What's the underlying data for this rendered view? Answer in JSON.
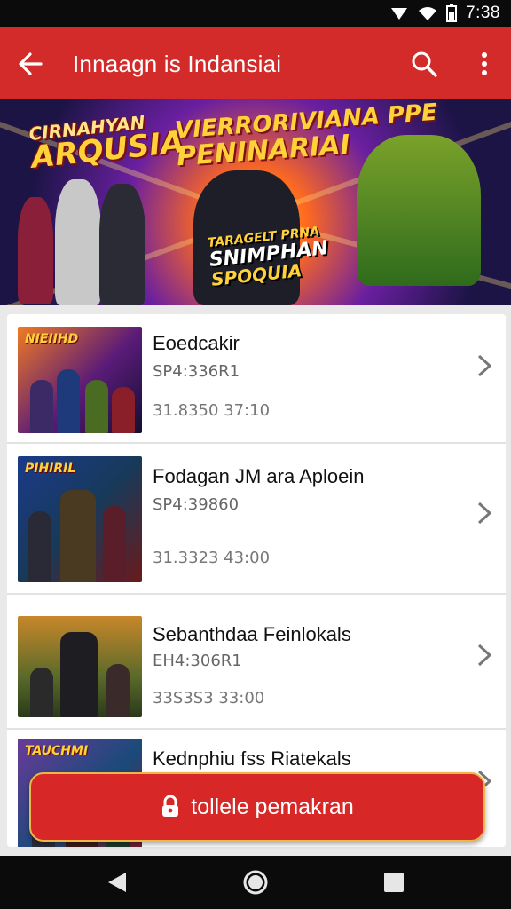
{
  "status_bar": {
    "time": "7:38"
  },
  "app_bar": {
    "title": "Innaagn is Indansiai"
  },
  "banner": {
    "left_small": "CIRNAHYAN",
    "left_big": "ARQUSIA",
    "center_line1": "VIERRORIVIANA PPE",
    "center_line2": "PENINARIAI",
    "badge_line1": "TARAGELT PRNA",
    "badge_line2": "SNIMPHAN",
    "badge_line3": "SPOQUIA"
  },
  "items": [
    {
      "title": "Eoedcakir",
      "code": "SP4:336R1",
      "meta": "31.8350 37:10",
      "thumb_label": "NIEIIHD"
    },
    {
      "title": "Fodagan JM ara Aploein",
      "code": "SP4:39860",
      "meta": "31.3323 43:00",
      "thumb_label": "PIHIRIL"
    },
    {
      "title": "Sebanthdaa Feinlokals",
      "code": "EH4:306R1",
      "meta": "33S3S3 33:00",
      "thumb_label": ""
    },
    {
      "title": "Kednphiu fss Riatekals",
      "code": "",
      "meta": "",
      "thumb_label": "TAUCHMI"
    }
  ],
  "cta": {
    "label": "tollele pemakran"
  }
}
